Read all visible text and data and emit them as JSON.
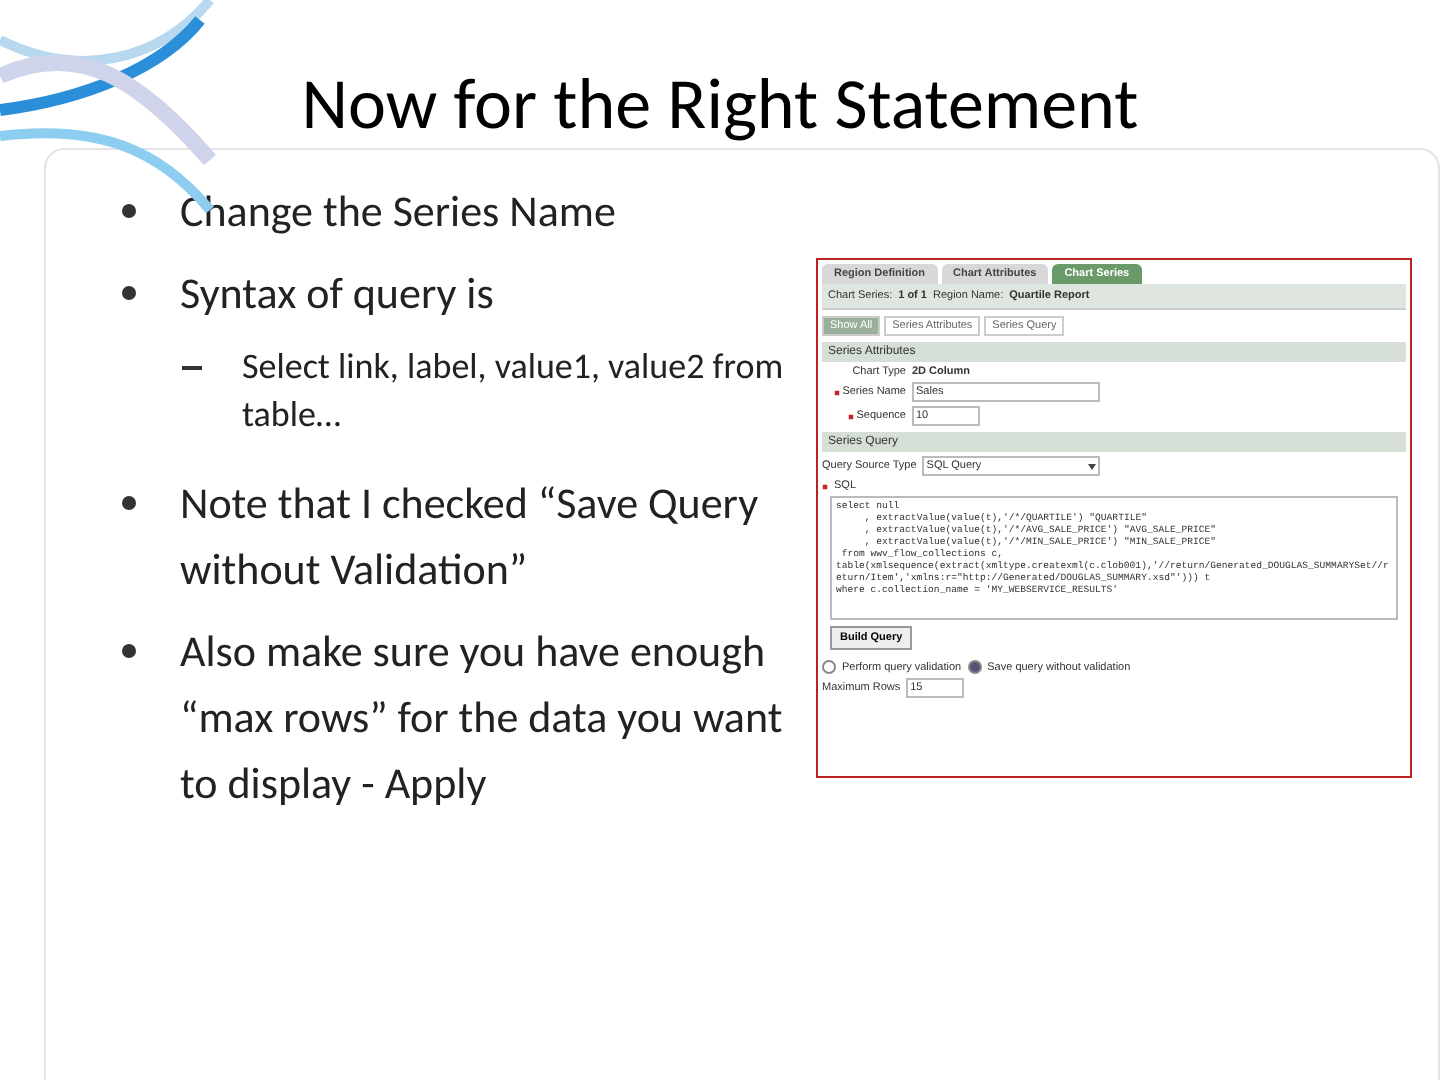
{
  "slide": {
    "title": "Now for the Right Statement",
    "bullets": [
      {
        "text": "Change the Series Name"
      },
      {
        "text": "Syntax of query is",
        "children": [
          {
            "text": "Select link, label, value1, value2 from table…"
          }
        ]
      },
      {
        "text": "Note that I checked “Save Query without Validation”"
      },
      {
        "text": "Also make sure you have enough “max rows” for the data you want to display - Apply"
      }
    ]
  },
  "app": {
    "tabs": [
      {
        "label": "Region Definition",
        "selected": false
      },
      {
        "label": "Chart Attributes",
        "selected": false
      },
      {
        "label": "Chart Series",
        "selected": true
      }
    ],
    "info": {
      "label": "Chart Series:",
      "value": "1 of 1",
      "region_label": "Region Name:",
      "region_value": "Quartile Report"
    },
    "subtabs": [
      {
        "label": "Show All",
        "selected": true
      },
      {
        "label": "Series Attributes",
        "selected": false
      },
      {
        "label": "Series Query",
        "selected": false
      }
    ],
    "series_attributes": {
      "heading": "Series Attributes",
      "chart_type_label": "Chart Type",
      "chart_type": "2D Column",
      "name_label": "Series Name",
      "name_value": "Sales",
      "seq_label": "Sequence",
      "seq_value": "10"
    },
    "series_query": {
      "heading": "Series Query",
      "source_label": "Query Source Type",
      "source_value": "SQL Query",
      "sql_label": "SQL",
      "sql": [
        "select null",
        "     , extractValue(value(t),'/*/QUARTILE') \"QUARTILE\"",
        "     , extractValue(value(t),'/*/AVG_SALE_PRICE') \"AVG_SALE_PRICE\"",
        "     , extractValue(value(t),'/*/MIN_SALE_PRICE') \"MIN_SALE_PRICE\"",
        " from wwv_flow_collections c,",
        "table(xmlsequence(extract(xmltype.createxml(c.clob001),'//return/Generated_DOUGLAS_SUMMARYSet//return/Item','xmlns:r=\"http://Generated/DOUGLAS_SUMMARY.xsd\"'))) t",
        "where c.collection_name = 'MY_WEBSERVICE_RESULTS'"
      ],
      "build_button": "Build Query",
      "validation": [
        {
          "label": "Perform query validation",
          "selected": false
        },
        {
          "label": "Save query without validation",
          "selected": true
        }
      ],
      "max_rows_label": "Maximum Rows",
      "max_rows_value": "15"
    }
  }
}
